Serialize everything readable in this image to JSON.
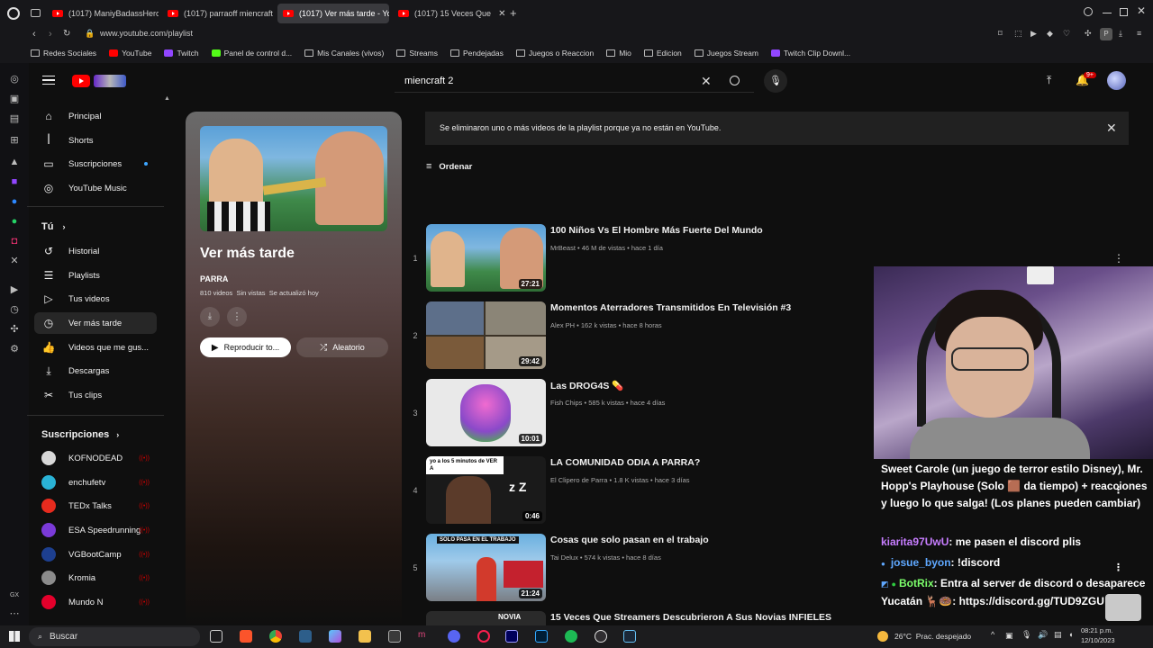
{
  "browser": {
    "tabs": [
      {
        "title": "(1017) ManiyBadassHero"
      },
      {
        "title": "(1017) parraoff miencraft"
      },
      {
        "title": "(1017) Ver más tarde - Yo"
      },
      {
        "title": "(1017) 15 Veces Que"
      }
    ],
    "url": "www.youtube.com/playlist",
    "bookmarks": [
      "Redes Sociales",
      "YouTube",
      "Twitch",
      "Panel de control d...",
      "Mis Canales (vivos)",
      "Streams",
      "Pendejadas",
      "Juegos o Reaccion",
      "Mio",
      "Edicion",
      "Juegos Stream",
      "Twitch Clip Downl..."
    ]
  },
  "header": {
    "search_value": "miencraft 2",
    "notification_count": "9+"
  },
  "nav": {
    "main": [
      {
        "label": "Principal",
        "icon": "home-icon"
      },
      {
        "label": "Shorts",
        "icon": "shorts-icon"
      },
      {
        "label": "Suscripciones",
        "icon": "subscriptions-icon"
      },
      {
        "label": "YouTube Music",
        "icon": "music-icon"
      }
    ],
    "you_title": "Tú",
    "you": [
      {
        "label": "Historial",
        "icon": "history-icon"
      },
      {
        "label": "Playlists",
        "icon": "playlists-icon"
      },
      {
        "label": "Tus videos",
        "icon": "your-videos-icon"
      },
      {
        "label": "Ver más tarde",
        "icon": "watch-later-icon"
      },
      {
        "label": "Videos que me gus...",
        "icon": "like-icon"
      },
      {
        "label": "Descargas",
        "icon": "download-icon"
      },
      {
        "label": "Tus clips",
        "icon": "scissors-icon"
      }
    ],
    "subs_title": "Suscripciones",
    "subs": [
      {
        "label": "KOFNODEAD",
        "color": "#d9d9d9"
      },
      {
        "label": "enchufetv",
        "color": "#2ab3d6"
      },
      {
        "label": "TEDx Talks",
        "color": "#e62b1e"
      },
      {
        "label": "ESA Speedrunning",
        "color": "#7a3ad8"
      },
      {
        "label": "VGBootCamp",
        "color": "#1d3f8f"
      },
      {
        "label": "Kromia",
        "color": "#8c8c8c"
      },
      {
        "label": "Mundo N",
        "color": "#e4002b"
      }
    ]
  },
  "playlist": {
    "title": "Ver más tarde",
    "owner": "PARRA",
    "stats": "810 videos  Sin vistas  Se actualizó hoy",
    "play_label": "Reproducir to...",
    "shuffle_label": "Aleatorio"
  },
  "notice": "Se eliminaron uno o más videos de la playlist porque ya no están en YouTube.",
  "sort_label": "Ordenar",
  "videos": [
    {
      "num": "1",
      "title": "100 Niños Vs El Hombre Más Fuerte Del Mundo",
      "meta": "MrBeast • 46 M de vistas • hace 1 día",
      "duration": "27:21"
    },
    {
      "num": "2",
      "title": "Momentos Aterradores Transmitidos En Televisión #3",
      "meta": "Alex PH • 162 k vistas • hace 8 horas",
      "duration": "29:42"
    },
    {
      "num": "3",
      "title": "Las DROG4S 💊",
      "meta": "Fish Chips • 585 k vistas • hace 4 días",
      "duration": "10:01"
    },
    {
      "num": "4",
      "title": "LA COMUNIDAD ODIA A PARRA?",
      "meta": "El Clipero de Parra • 1.8 K vistas • hace 3 días",
      "duration": "0:46"
    },
    {
      "num": "5",
      "title": "Cosas que solo pasan en el trabajo",
      "meta": "Tai Delux • 574 k vistas • hace 8 días",
      "duration": "21:24"
    },
    {
      "num": "",
      "title": "15 Veces Que Streamers Descubrieron A Sus Novias INFIELES",
      "meta": "",
      "duration": ""
    }
  ],
  "thumb_text": {
    "v4_caption": "yo a los 5 minutos de VER A",
    "v5_caption": "SOLO PASA EN EL TRABAJO",
    "v6_caption": "NOVIA"
  },
  "chat": {
    "title_message": "Sweet Carole (un juego de terror estilo Disney), Mr. Hopp's Playhouse (Solo 🟫 da tiempo) + reacciones y luego lo que salga! (Los planes pueden cambiar)",
    "messages": [
      {
        "user": "kiarita97UwU",
        "text": ": me pasen el discord plis",
        "color": "#c77dff"
      },
      {
        "user": "josue_byon",
        "text": ": !discord",
        "color": "#5fa8ff"
      },
      {
        "user": "BotRix",
        "text": ": Entra al server de discord o desaparece Yucatán 🦌🍩: https://discord.gg/TUD9ZGU",
        "color": "#7cff6b"
      }
    ]
  },
  "taskbar": {
    "search_placeholder": "Buscar",
    "weather": "26°C  Prac. despejado",
    "time": "08:21 p.m.",
    "date": "12/10/2023"
  }
}
